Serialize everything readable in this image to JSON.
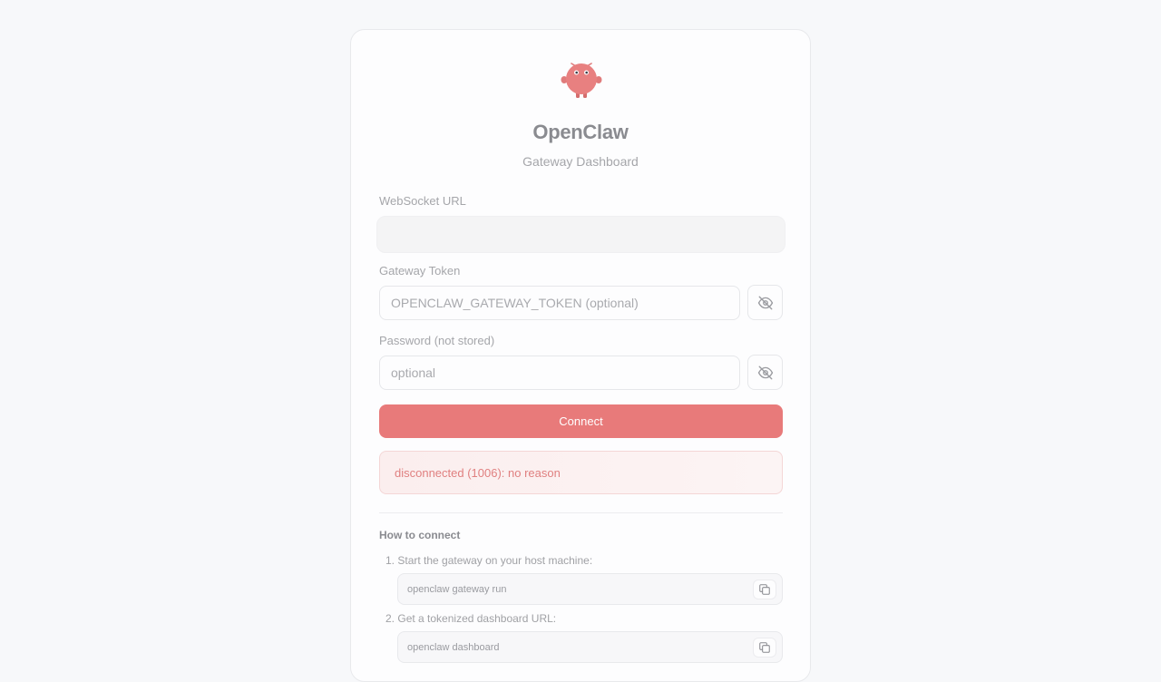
{
  "brand": {
    "title": "OpenClaw",
    "subtitle": "Gateway Dashboard",
    "logo_icon": "crab-mascot-icon",
    "accent_color": "#e87a7a"
  },
  "form": {
    "websocket_url": {
      "label": "WebSocket URL",
      "value": ""
    },
    "gateway_token": {
      "label": "Gateway Token",
      "placeholder": "OPENCLAW_GATEWAY_TOKEN (optional)",
      "value": "",
      "visibility_icon": "eye-off-icon"
    },
    "password": {
      "label": "Password (not stored)",
      "placeholder": "optional",
      "value": "",
      "visibility_icon": "eye-off-icon"
    },
    "connect_label": "Connect"
  },
  "status": {
    "error": "disconnected (1006): no reason"
  },
  "how_to": {
    "title": "How to connect",
    "steps": [
      {
        "number": "1.",
        "text": "Start the gateway on your host machine:",
        "command": "openclaw gateway run",
        "copy_icon": "copy-icon"
      },
      {
        "number": "2.",
        "text": "Get a tokenized dashboard URL:",
        "command": "openclaw dashboard",
        "copy_icon": "copy-icon"
      }
    ]
  }
}
